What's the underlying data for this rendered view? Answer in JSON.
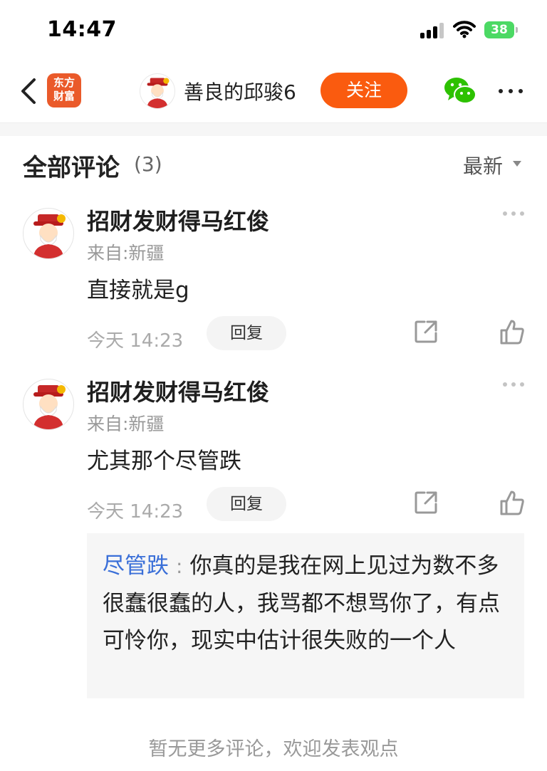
{
  "status_bar": {
    "time": "14:47",
    "battery": "38"
  },
  "nav": {
    "logo_line1": "东方",
    "logo_line2": "财富",
    "username": "善良的邱骏6",
    "follow_label": "关注"
  },
  "comments_header": {
    "title": "全部评论",
    "count": "(3)",
    "sort_label": "最新"
  },
  "comments": [
    {
      "author": "招财发财得马红俊",
      "location": "来自:新疆",
      "text": "直接就是g",
      "time": "今天 14:23",
      "reply_label": "回复"
    },
    {
      "author": "招财发财得马红俊",
      "location": "来自:新疆",
      "text": "尤其那个尽管跌",
      "time": "今天 14:23",
      "reply_label": "回复"
    }
  ],
  "quoted_reply": {
    "author": "尽管跌",
    "separator": ":",
    "text": "你真的是我在网上见过为数不多很蠢很蠢的人，我骂都不想骂你了，有点可怜你，现实中估计很失败的一个人"
  },
  "footer": {
    "note": "暂无更多评论，欢迎发表观点"
  },
  "colors": {
    "accent": "#fa5b0f",
    "link_blue": "#3a6fd8",
    "logo_red": "#ea5a2a",
    "wechat_green": "#2dc100"
  }
}
